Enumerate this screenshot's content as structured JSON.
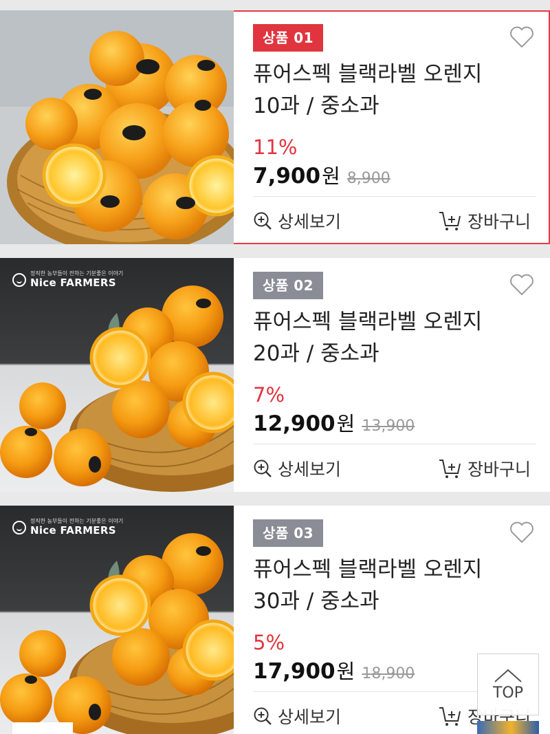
{
  "products": [
    {
      "badge": "상품 01",
      "title_line1": "퓨어스펙 블랙라벨 오렌지",
      "title_line2": "10과 / 중소과",
      "discount": "11%",
      "price": "7,900",
      "price_unit": "원",
      "original_price": "8,900",
      "detail_label": "상세보기",
      "cart_label": "장바구니",
      "selected": true
    },
    {
      "badge": "상품 02",
      "title_line1": "퓨어스펙 블랙라벨 오렌지",
      "title_line2": "20과 / 중소과",
      "discount": "7%",
      "price": "12,900",
      "price_unit": "원",
      "original_price": "13,900",
      "detail_label": "상세보기",
      "cart_label": "장바구니",
      "brand_tagline": "정직한 농부들이 전하는 기분좋은 이야기",
      "brand_name": "Nice FARMERS"
    },
    {
      "badge": "상품 03",
      "title_line1": "퓨어스펙 블랙라벨 오렌지",
      "title_line2": "30과 / 중소과",
      "discount": "5%",
      "price": "17,900",
      "price_unit": "원",
      "original_price": "18,900",
      "detail_label": "상세보기",
      "cart_label": "장바구니",
      "brand_tagline": "정직한 농부들이 전하는 기분좋은 이야기",
      "brand_name": "Nice FARMERS"
    }
  ],
  "top_button": {
    "label": "TOP",
    "icon": "chevron-up-icon"
  },
  "icons": {
    "wishlist": "heart-icon",
    "detail": "zoom-in-icon",
    "cart": "cart-add-icon"
  },
  "colors": {
    "accent": "#e0353f",
    "badge_gray": "#8a8d96",
    "background": "#e9e9e9"
  }
}
